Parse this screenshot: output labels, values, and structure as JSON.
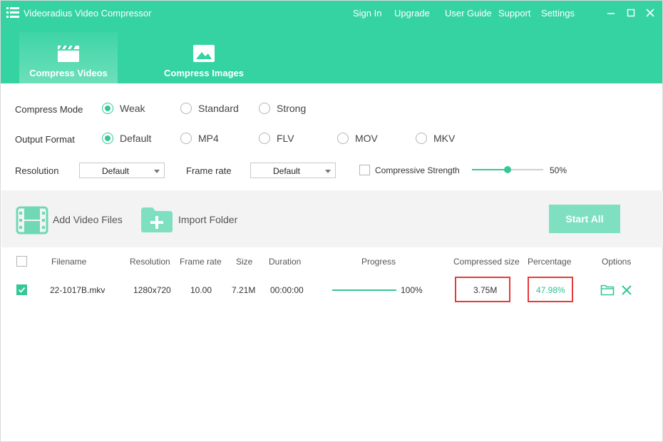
{
  "app": {
    "title": "Videoradius Video Compressor"
  },
  "nav": {
    "sign_in": "Sign In",
    "upgrade": "Upgrade",
    "user_guide": "User Guide",
    "support": "Support",
    "settings": "Settings"
  },
  "tabs": [
    {
      "label": "Compress Videos",
      "icon": "clapperboard-icon",
      "active": true
    },
    {
      "label": "Compress Images",
      "icon": "image-icon",
      "active": false
    }
  ],
  "settings": {
    "compress_mode": {
      "label": "Compress Mode",
      "options": [
        "Weak",
        "Standard",
        "Strong"
      ],
      "selected": "Weak"
    },
    "output_format": {
      "label": "Output Format",
      "options": [
        "Default",
        "MP4",
        "FLV",
        "MOV",
        "MKV"
      ],
      "selected": "Default"
    },
    "resolution": {
      "label": "Resolution",
      "value": "Default"
    },
    "frame_rate": {
      "label": "Frame rate",
      "value": "Default"
    },
    "compressive_strength": {
      "label": "Compressive Strength",
      "checked": false,
      "value_text": "50%",
      "value_fraction": 0.5
    }
  },
  "toolbar": {
    "add_video_files": "Add Video Files",
    "import_folder": "Import Folder",
    "start_all": "Start All"
  },
  "table": {
    "headers": {
      "filename": "Filename",
      "resolution": "Resolution",
      "frame_rate": "Frame rate",
      "size": "Size",
      "duration": "Duration",
      "progress": "Progress",
      "compressed_size": "Compressed size",
      "percentage": "Percentage",
      "options": "Options"
    },
    "rows": [
      {
        "checked": true,
        "filename": "22-1017B.mkv",
        "resolution": "1280x720",
        "frame_rate": "10.00",
        "size": "7.21M",
        "duration": "00:00:00",
        "progress_text": "100%",
        "progress_fraction": 1.0,
        "compressed_size": "3.75M",
        "percentage": "47.98%"
      }
    ]
  },
  "colors": {
    "accent": "#35d3a1",
    "accent_dark": "#35c796",
    "highlight_box": "#e63a3a",
    "start_button": "#7ee0c0"
  }
}
